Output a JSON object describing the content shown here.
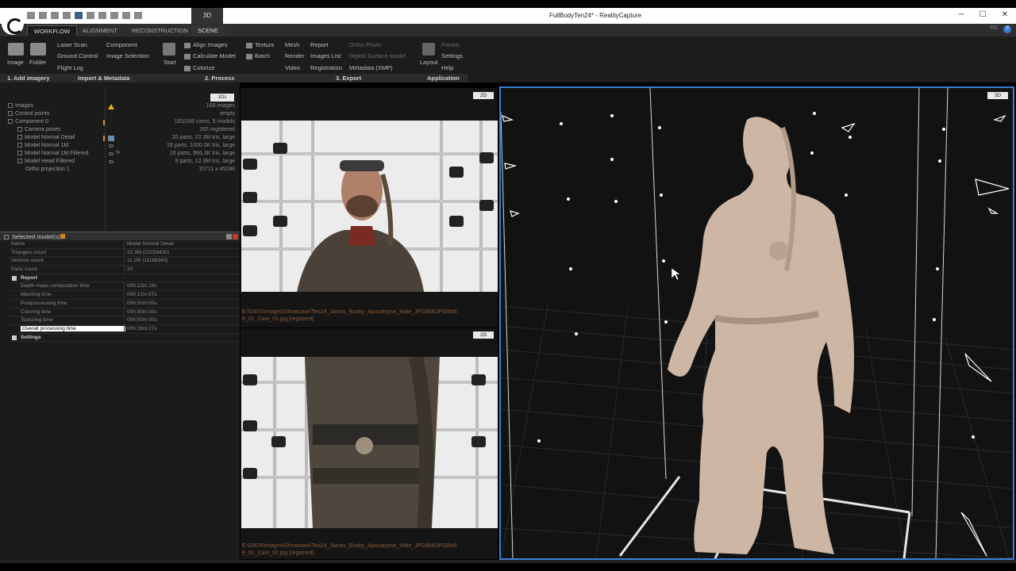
{
  "window": {
    "title": "FullBodyTen24* - RealityCapture",
    "tab_3d": "3D",
    "minimize": "─",
    "maximize": "☐",
    "close": "✕"
  },
  "ribbon_tabs": [
    "WORKFLOW",
    "ALIGNMENT",
    "RECONSTRUCTION",
    "SCENE"
  ],
  "rc_label": "RC",
  "help_label": "?",
  "ribbon": {
    "image": "Image",
    "folder": "Folder",
    "laser_scan": "Laser Scan",
    "component": "Component",
    "ground_control": "Ground Control",
    "image_selection": "Image Selection",
    "flight_log": "Flight Log",
    "start": "Start",
    "align_images": "Align Images",
    "calculate_model": "Calculate Model",
    "colorize": "Colorize",
    "texture": "Texture",
    "batch": "Batch",
    "mesh": "Mesh",
    "render": "Render",
    "video": "Video",
    "report": "Report",
    "images_list": "Images List",
    "registration": "Registration",
    "ortho_photo": "Ortho Photo",
    "digital_surface_model": "Digital Surface Model",
    "metadata_xmp": "Metadata (XMP)",
    "layout": "Layout",
    "panels": "Panels",
    "settings": "Settings",
    "help": "Help"
  },
  "sections": [
    "1. Add imagery",
    "Import & Metadata",
    "2. Process",
    "3. Export",
    "Application"
  ],
  "tree": {
    "header_tag": "1Ds",
    "rows": [
      {
        "name": "Images",
        "value": "168 images"
      },
      {
        "name": "Control points",
        "value": "empty"
      },
      {
        "name": "Component 0",
        "value": "165/168 cams, 5 models"
      },
      {
        "name": "Camera poses",
        "value": "165 registered"
      },
      {
        "name": "Model Normal Detail",
        "value": "20 parts, 22.3M tris, large"
      },
      {
        "name": "Model Normal 1M",
        "value": "19 parts, 1000.0K tris, large"
      },
      {
        "name": "Model Normal 1M Filtered",
        "value": "16 parts, 966.3K tris, large"
      },
      {
        "name": "Model Head Filtered",
        "value": "9 parts, 12.3M tris, large"
      },
      {
        "name": "Ortho projection 1",
        "value": "15711 x 45288"
      }
    ],
    "eye_mark": "%"
  },
  "selected_models": {
    "title": "Selected model(s)",
    "rows": [
      {
        "k": "Name",
        "v": "Model Normal Detail"
      },
      {
        "k": "Triangles count",
        "v": "22.3M (22259430)"
      },
      {
        "k": "Vertices count",
        "v": "11.2M (11168343)"
      },
      {
        "k": "Parts count",
        "v": "20"
      },
      {
        "k": "Report",
        "v": ""
      },
      {
        "k": "Depth-maps computation time",
        "v": "00h:15m:29s"
      },
      {
        "k": "Meshing time",
        "v": "00h:12m:57s"
      },
      {
        "k": "Postprocessing time",
        "v": "00h:00m:00s"
      },
      {
        "k": "Coloring time",
        "v": "00h:00m:00s"
      },
      {
        "k": "Texturing time",
        "v": "00h:00m:00s"
      },
      {
        "k": "Overall processing time",
        "v": "00h:28m:27s"
      },
      {
        "k": "Settings",
        "v": ""
      }
    ]
  },
  "views": {
    "top_tag": "2D",
    "top_path": "E:\\DATA\\Images\\Showcase\\Ten24_James_Busby_Apocalypse_Male_JPG8bit\\JPG8bit\\ 8_01_Cam_01.jpg [registred]",
    "bottom_tag": "2D",
    "bottom_path": "E:\\DATA\\Images\\Showcase\\Ten24_James_Busby_Apocalypse_Male_JPG8bit\\JPG8bit\\ 8_01_Cam_02.jpg [registred]",
    "viewport_tag": "3D"
  },
  "colors": {
    "accent": "#3a7fd4",
    "warning": "#e5b21f",
    "path": "#8a5a3a",
    "model": "#cdb7a4"
  }
}
